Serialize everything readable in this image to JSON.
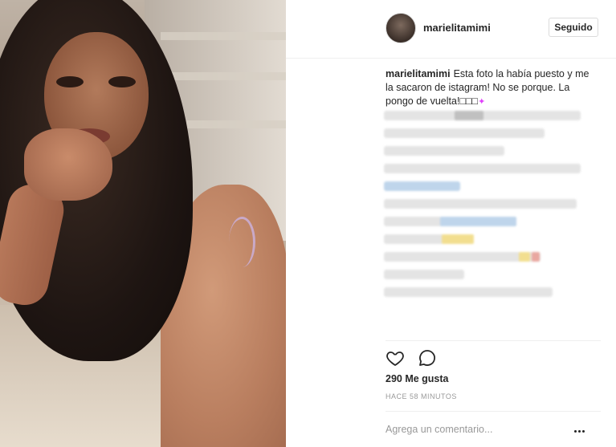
{
  "post": {
    "username": "marielitamimi",
    "follow_label": "Seguido",
    "caption_user": "marielitamimi",
    "caption_text": "Esta foto la había puesto y me la sacaron de istagram! No se porque. La pongo de vuelta!",
    "caption_emojis": "□□□",
    "likes": "290 Me gusta",
    "timestamp": "HACE 58 MINUTOS",
    "comment_placeholder": "Agrega un comentario..."
  },
  "colors": {
    "accent_blur_blue": "#bcd3ea",
    "accent_blur_yellow": "#f2dd8a",
    "accent_blur_red": "#e8a39b",
    "text": "#262626",
    "muted": "#999999"
  },
  "icons": {
    "like": "heart-icon",
    "comment": "comment-bubble-icon",
    "more": "more-options-icon",
    "sparkle": "sparkle-icon"
  }
}
